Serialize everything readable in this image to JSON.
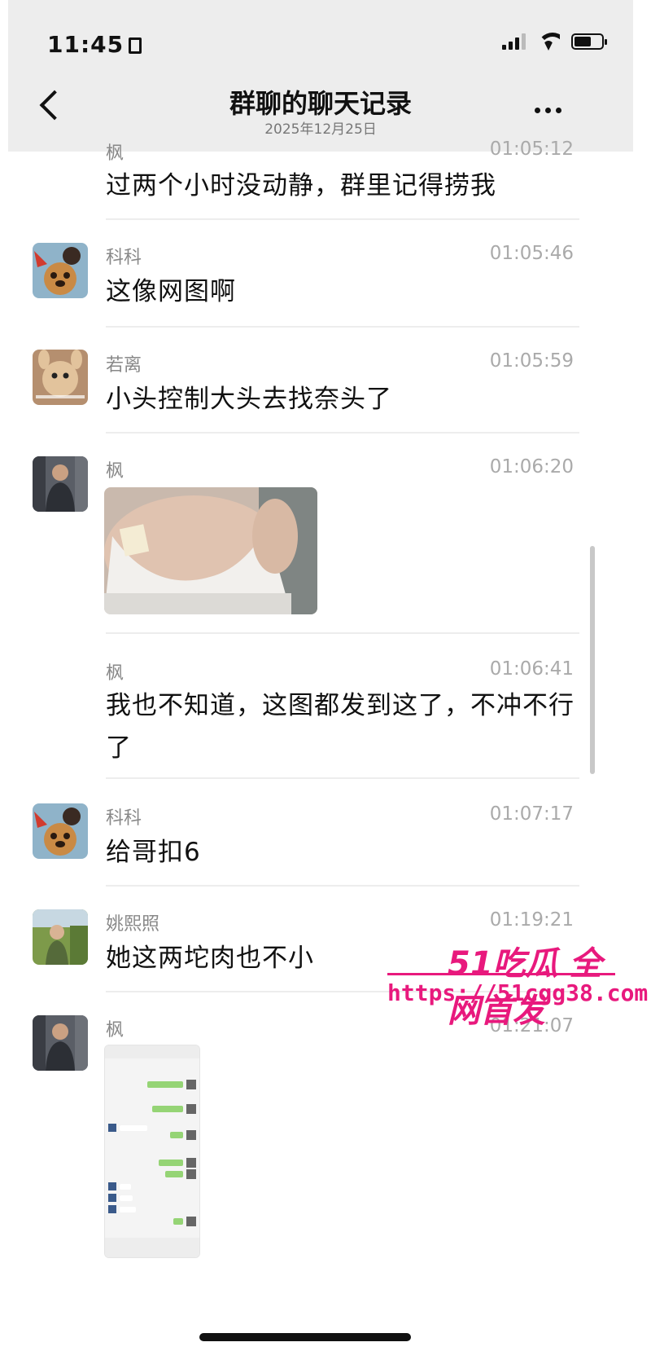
{
  "status_bar": {
    "time": "11:45"
  },
  "header": {
    "title": "群聊的聊天记录",
    "date": "2025年12月25日"
  },
  "messages": [
    {
      "sender": "枫",
      "time": "01:05:12",
      "text": "过两个小时没动静，群里记得捞我"
    },
    {
      "sender": "科科",
      "time": "01:05:46",
      "text": "这像网图啊"
    },
    {
      "sender": "若离",
      "time": "01:05:59",
      "text": "小头控制大头去找奈头了"
    },
    {
      "sender": "枫",
      "time": "01:06:20",
      "type": "image"
    },
    {
      "sender": "枫",
      "time": "01:06:41",
      "text": "我也不知道，这图都发到这了，不冲不行了"
    },
    {
      "sender": "科科",
      "time": "01:07:17",
      "text": "给哥扣6"
    },
    {
      "sender": "姚熙照",
      "time": "01:19:21",
      "text": "她这两坨肉也不小"
    },
    {
      "sender": "枫",
      "time": "01:21:07",
      "type": "screenshot"
    }
  ],
  "watermark": {
    "brand": "51吃瓜 全网首发",
    "url": "https://51cgg38.com"
  },
  "colors": {
    "header_bg": "#ededed",
    "watermark": "#e8197d",
    "timestamp": "#aaaaaa"
  }
}
